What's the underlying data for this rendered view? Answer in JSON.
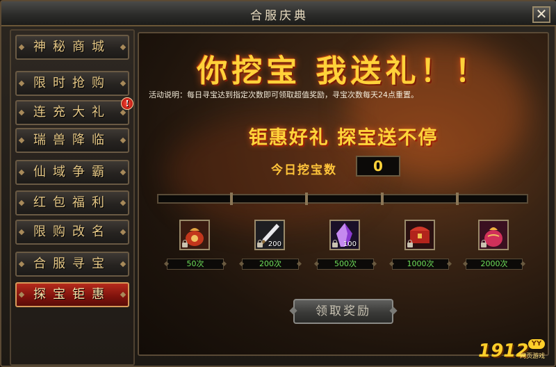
{
  "window": {
    "title": "合服庆典",
    "close_label": "✕"
  },
  "sidebar": {
    "items": [
      {
        "label": "神秘商城",
        "active": false,
        "alert": false
      },
      {
        "label": "限时抢购",
        "active": false,
        "alert": false
      },
      {
        "label": "连充大礼",
        "active": false,
        "alert": true
      },
      {
        "label": "瑞兽降临",
        "active": false,
        "alert": false
      },
      {
        "label": "仙域争霸",
        "active": false,
        "alert": false
      },
      {
        "label": "红包福利",
        "active": false,
        "alert": false
      },
      {
        "label": "限购改名",
        "active": false,
        "alert": false
      },
      {
        "label": "合服寻宝",
        "active": false,
        "alert": false
      },
      {
        "label": "探宝钜惠",
        "active": true,
        "alert": false
      }
    ],
    "alert_label": "!"
  },
  "main": {
    "headline": "你挖宝 我送礼！！",
    "description": "活动说明：每日寻宝达到指定次数即可领取超值奖励，寻宝次数每天24点重置。",
    "subheadline": "钜惠好礼 探宝送不停",
    "count_label": "今日挖宝数",
    "count_value": "0",
    "rewards": [
      {
        "icon": "red-pouch-icon",
        "qty": "",
        "requirement": "50次"
      },
      {
        "icon": "dagger-icon",
        "qty": "200",
        "requirement": "200次"
      },
      {
        "icon": "purple-crystal-icon",
        "qty": "100",
        "requirement": "500次"
      },
      {
        "icon": "treasure-chest-icon",
        "qty": "",
        "requirement": "1000次"
      },
      {
        "icon": "gift-bag-icon",
        "qty": "",
        "requirement": "2000次"
      }
    ],
    "claim_button": "领取奖励"
  },
  "watermark": {
    "number": "1912",
    "badge": "YY",
    "caption": "网页游戏"
  },
  "colors": {
    "accent_gold": "#ffd23a",
    "active_red": "#9a1a10",
    "requirement_green": "#6ee05a"
  }
}
